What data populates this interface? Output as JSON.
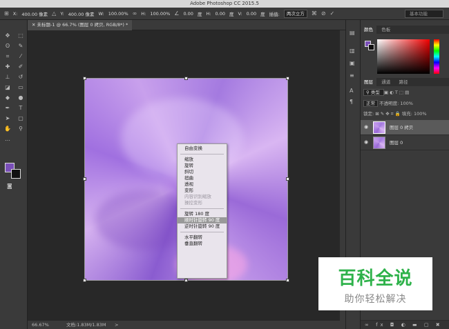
{
  "app": {
    "title": "Adobe Photoshop CC 2015.5"
  },
  "options_bar": {
    "x_label": "X:",
    "x_value": "400.00 像素",
    "y_label": "Y:",
    "y_value": "400.00 像素",
    "w_label": "W:",
    "w_value": "100.00%",
    "h_label": "H:",
    "h_value": "100.00%",
    "angle_value": "0.00",
    "angle_unit": "度",
    "hskew_label": "H:",
    "hskew_value": "0.00",
    "hskew_unit": "度",
    "vskew_label": "V:",
    "vskew_value": "0.00",
    "vskew_unit": "度",
    "interp_label": "插值:",
    "interp_value": "两次立方",
    "workspace": "基本功能"
  },
  "document": {
    "tab_title": "未标题-1 @ 66.7% (图层 0 拷贝, RGB/8*) *",
    "zoom": "66.67%",
    "doc_info": "文档:1.83M/1.83M",
    "nav_arrow": ">"
  },
  "context_menu": {
    "items": [
      {
        "label": "自由变换",
        "state": "normal"
      },
      {
        "label": "缩放",
        "state": "normal"
      },
      {
        "label": "旋转",
        "state": "normal"
      },
      {
        "label": "斜切",
        "state": "normal"
      },
      {
        "label": "扭曲",
        "state": "normal"
      },
      {
        "label": "透视",
        "state": "normal"
      },
      {
        "label": "变形",
        "state": "normal"
      },
      {
        "label": "内容识别缩放",
        "state": "disabled"
      },
      {
        "label": "操控变形",
        "state": "disabled"
      },
      {
        "label": "旋转 180 度",
        "state": "normal"
      },
      {
        "label": "顺时针旋转 90 度",
        "state": "active"
      },
      {
        "label": "逆时针旋转 90 度",
        "state": "normal"
      },
      {
        "label": "水平翻转",
        "state": "normal"
      },
      {
        "label": "垂直翻转",
        "state": "normal"
      }
    ]
  },
  "color_panel": {
    "tabs": [
      "颜色",
      "色板"
    ],
    "foreground": "#7a4fb8",
    "background": "#111111"
  },
  "layers_panel": {
    "tabs": [
      "图层",
      "通道",
      "路径"
    ],
    "kind_filter": "类型",
    "blend_mode": "正常",
    "opacity_label": "不透明度:",
    "opacity_value": "100%",
    "lock_label": "锁定:",
    "fill_label": "填充:",
    "fill_value": "100%",
    "layers": [
      {
        "name": "图层 0 拷贝",
        "selected": true
      },
      {
        "name": "图层 0",
        "selected": false
      }
    ],
    "footer_icons": "fx"
  },
  "watermark": {
    "title": "百科全说",
    "subtitle": "助你轻松解决"
  },
  "colors": {
    "accent_green": "#2eb24a",
    "image_purple": "#a77ee0"
  }
}
